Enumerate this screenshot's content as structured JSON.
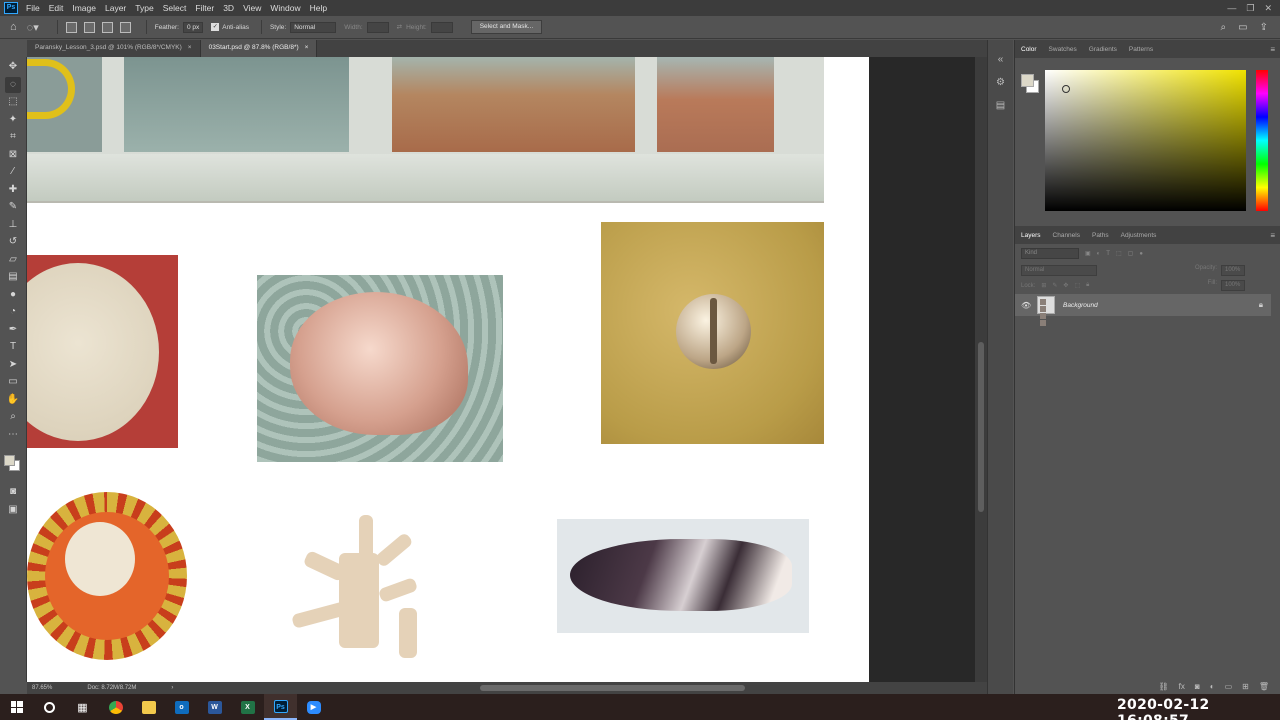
{
  "app": {
    "logo": "Ps",
    "menu": [
      "File",
      "Edit",
      "Image",
      "Layer",
      "Type",
      "Select",
      "Filter",
      "3D",
      "View",
      "Window",
      "Help"
    ]
  },
  "options": {
    "feather_label": "Feather:",
    "feather_value": "0 px",
    "antialias_label": "Anti-alias",
    "style_label": "Style:",
    "style_value": "Normal",
    "width_label": "Width:",
    "height_label": "Height:",
    "select_mask_label": "Select and Mask..."
  },
  "tabs": [
    {
      "label": "Paransky_Lesson_3.psd @ 101% (RGB/8*/CMYK)",
      "close": "×"
    },
    {
      "label": "03Start.psd @ 87.8% (RGB/8*)",
      "close": "×"
    }
  ],
  "status": {
    "zoom": "87.65%",
    "doc": "Doc: 8.72M/8.72M",
    "arrow": "›"
  },
  "color_panel": {
    "tabs": [
      "Color",
      "Swatches",
      "Gradients",
      "Patterns"
    ],
    "fg_color": "#dcd8c8",
    "bg_color": "#ffffff"
  },
  "layers_panel": {
    "tabs": [
      "Layers",
      "Channels",
      "Paths",
      "Adjustments"
    ],
    "filter_placeholder": "Kind",
    "blend_mode": "Normal",
    "opacity_label": "Opacity:",
    "opacity_value": "100%",
    "lock_label": "Lock:",
    "fill_label": "Fill:",
    "fill_value": "100%",
    "layers": [
      {
        "name": "Background",
        "visible": true,
        "locked": true
      }
    ]
  },
  "taskbar": {
    "datetime": "2020-02-12  16:08:57"
  },
  "accent": {
    "ps_blue": "#31a8ff",
    "canvas_bg": "#282828",
    "panel_bg": "#535353"
  }
}
